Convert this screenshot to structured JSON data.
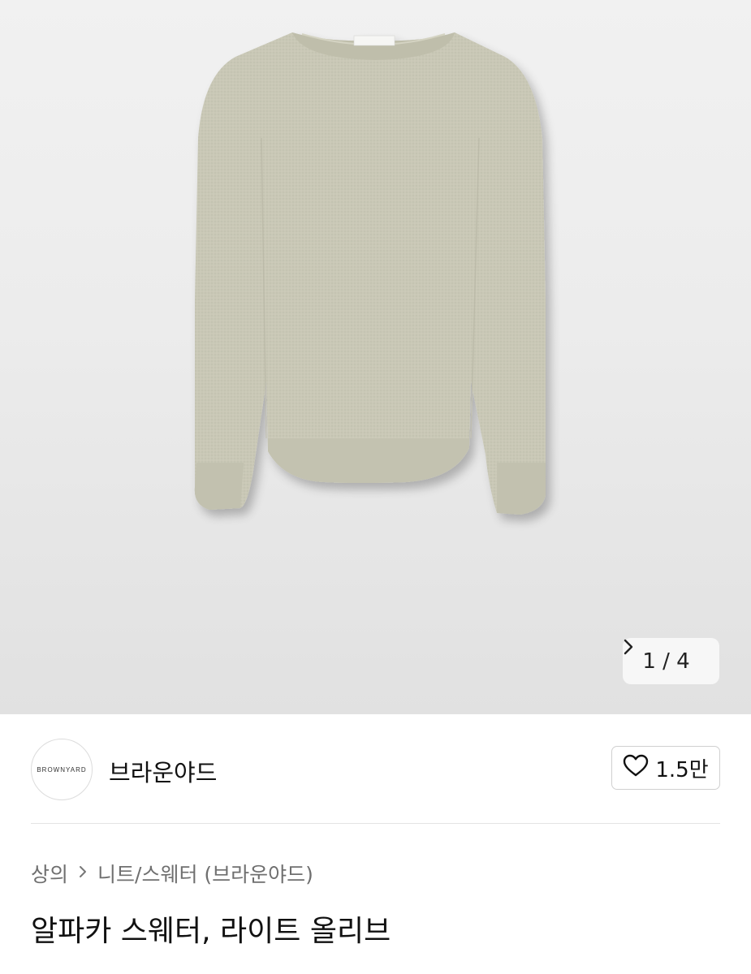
{
  "product_image": {
    "tag_text": "BROWNYARD",
    "pager": {
      "current": "1",
      "total": "4",
      "label": "1 / 4"
    }
  },
  "brand": {
    "logo_text": "BROWNYARD",
    "name": "브라운야드"
  },
  "like": {
    "count": "1.5만"
  },
  "breadcrumb": {
    "category": "상의",
    "subcategory": "니트/스웨터 (브라운야드)"
  },
  "product": {
    "title": "알파카 스웨터, 라이트 올리브"
  },
  "colors": {
    "sweater": "#c8c7b5",
    "sweater_shade": "#b9b8a6",
    "text_primary": "#111111",
    "text_secondary": "#6f6f6f"
  }
}
